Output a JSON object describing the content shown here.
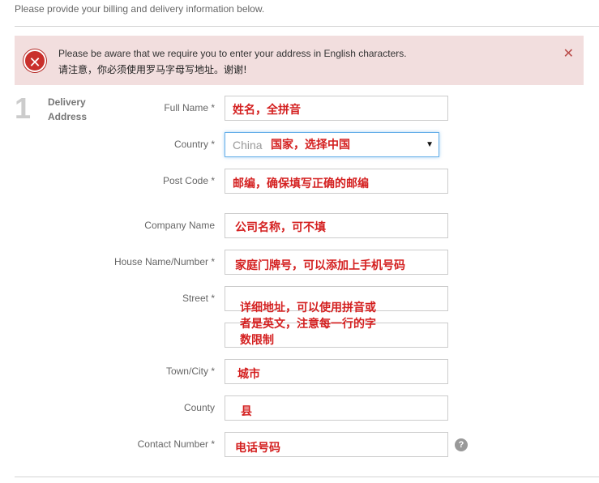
{
  "intro": "Please provide your billing and delivery information below.",
  "alert": {
    "icon": "error-x-icon",
    "line1": "Please be aware that we require you to enter your address in English characters.",
    "line2": "请注意，你必须使用罗马字母写地址。谢谢!",
    "close": "✕"
  },
  "step": {
    "number": "1",
    "title": "Delivery Address"
  },
  "form": {
    "full_name": {
      "label": "Full Name *",
      "note": "姓名，全拼音"
    },
    "country": {
      "label": "Country *",
      "value": "China",
      "note": "国家，选择中国"
    },
    "post_code": {
      "label": "Post Code *",
      "note": "邮编，确保填写正确的邮编"
    },
    "company": {
      "label": "Company Name",
      "note": "公司名称，可不填"
    },
    "house": {
      "label": "House Name/Number *",
      "note": "家庭门牌号，可以添加上手机号码"
    },
    "street": {
      "label": "Street *",
      "note": "详细地址，可以使用拼音或者是英文，注意每一行的字数限制"
    },
    "town": {
      "label": "Town/City *",
      "note": "城市"
    },
    "county": {
      "label": "County",
      "note": "县"
    },
    "contact": {
      "label": "Contact Number *",
      "note": "电话号码",
      "help": "?"
    }
  },
  "colors": {
    "alert_bg": "#f2dede",
    "error_red": "#c9302c",
    "note_red": "#d42020"
  }
}
